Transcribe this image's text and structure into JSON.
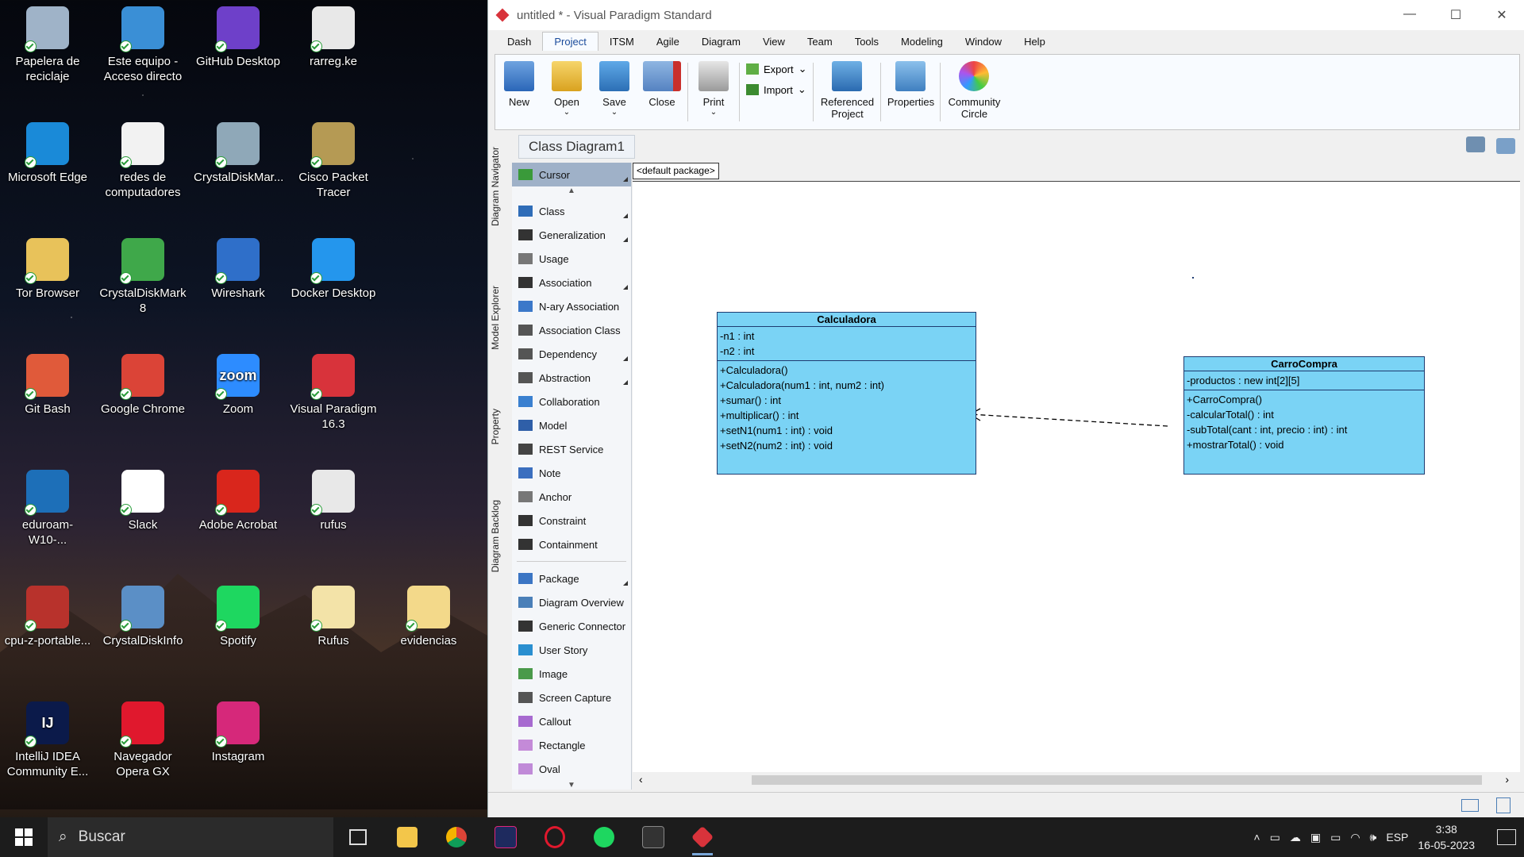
{
  "desktop": {
    "icons": [
      {
        "label": "Papelera de reciclaje",
        "color": "#9fb3c8"
      },
      {
        "label": "Este equipo - Acceso directo",
        "color": "#3a8fd6"
      },
      {
        "label": "GitHub Desktop",
        "color": "#6e40c9"
      },
      {
        "label": "rarreg.ke",
        "color": "#e8e8e8"
      },
      {
        "label": "Microsoft Edge",
        "color": "#1a8ad8"
      },
      {
        "label": "redes de computadores",
        "color": "#f2f2f2"
      },
      {
        "label": "CrystalDiskMar...",
        "color": "#8fa8b8"
      },
      {
        "label": "Cisco Packet Tracer",
        "color": "#b59a54"
      },
      {
        "label": "Tor Browser",
        "color": "#e8c25a"
      },
      {
        "label": "CrystalDiskMark 8",
        "color": "#3fa84a"
      },
      {
        "label": "Wireshark",
        "color": "#2f6fc9"
      },
      {
        "label": "Docker Desktop",
        "color": "#2496ed"
      },
      {
        "label": "Git Bash",
        "color": "#e05a3a"
      },
      {
        "label": "Google Chrome",
        "color": "#db4437"
      },
      {
        "label": "Zoom",
        "color": "#2d8cff"
      },
      {
        "label": "Visual Paradigm 16.3",
        "color": "#d8333b"
      },
      {
        "label": "eduroam-W10-...",
        "color": "#1d6fb8"
      },
      {
        "label": "Slack",
        "color": "#ffffff"
      },
      {
        "label": "Adobe Acrobat",
        "color": "#d9261c"
      },
      {
        "label": "rufus",
        "color": "#e8e8e8"
      },
      {
        "label": "cpu-z-portable...",
        "color": "#b8322c"
      },
      {
        "label": "CrystalDiskInfo",
        "color": "#5b8fc6"
      },
      {
        "label": "Spotify",
        "color": "#1ed760"
      },
      {
        "label": "Rufus",
        "color": "#f3e3a8"
      },
      {
        "label": "evidencias",
        "color": "#f3d98a"
      },
      {
        "label": "IntelliJ IDEA Community E...",
        "color": "#0b1a4a"
      },
      {
        "label": "Navegador Opera GX",
        "color": "#e0182d"
      },
      {
        "label": "Instagram",
        "color": "#d6287a"
      }
    ],
    "icon_glyphs": {
      "Zoom": "zoom",
      "IntelliJ IDEA Community E...": "IJ"
    }
  },
  "window": {
    "title": "untitled * - Visual Paradigm Standard",
    "controls": [
      "—",
      "☐",
      "✕"
    ],
    "menu": [
      "Dash",
      "Project",
      "ITSM",
      "Agile",
      "Diagram",
      "View",
      "Team",
      "Tools",
      "Modeling",
      "Window",
      "Help"
    ],
    "active_menu": "Project",
    "ribbon": {
      "new": "New",
      "open": "Open",
      "save": "Save",
      "close": "Close",
      "print": "Print",
      "export": "Export",
      "import": "Import",
      "referenced": [
        "Referenced",
        "Project"
      ],
      "properties": "Properties",
      "community": [
        "Community",
        "Circle"
      ]
    },
    "side_tabs": [
      "Diagram Navigator",
      "Model Explorer",
      "Property",
      "Diagram Backlog"
    ],
    "diagram_tab": "Class Diagram1",
    "package": "<default package>",
    "palette": [
      "Cursor",
      "Class",
      "Generalization",
      "Usage",
      "Association",
      "N-ary Association",
      "Association Class",
      "Dependency",
      "Abstraction",
      "Collaboration",
      "Model",
      "REST Service",
      "Note",
      "Anchor",
      "Constraint",
      "Containment",
      "Package",
      "Diagram Overview",
      "Generic Connector",
      "User Story",
      "Image",
      "Screen Capture",
      "Callout",
      "Rectangle",
      "Oval"
    ],
    "classes": {
      "calc": {
        "name": "Calculadora",
        "attributes": [
          "-n1 : int",
          "-n2 : int"
        ],
        "operations": [
          "+Calculadora()",
          "+Calculadora(num1 : int, num2 : int)",
          "+sumar() : int",
          "+multiplicar() : int",
          "+setN1(num1 : int) : void",
          "+setN2(num2 : int) : void"
        ]
      },
      "carro": {
        "name": "CarroCompra",
        "attributes": [
          "-productos : new int[2][5]"
        ],
        "operations": [
          "+CarroCompra()",
          "-calcularTotal() : int",
          "-subTotal(cant : int, precio : int) : int",
          "+mostrarTotal() : void"
        ]
      }
    },
    "class_color": "#7ad3f5"
  },
  "taskbar": {
    "search_placeholder": "Buscar",
    "lang": "ESP",
    "time": "3:38",
    "date": "16-05-2023"
  }
}
